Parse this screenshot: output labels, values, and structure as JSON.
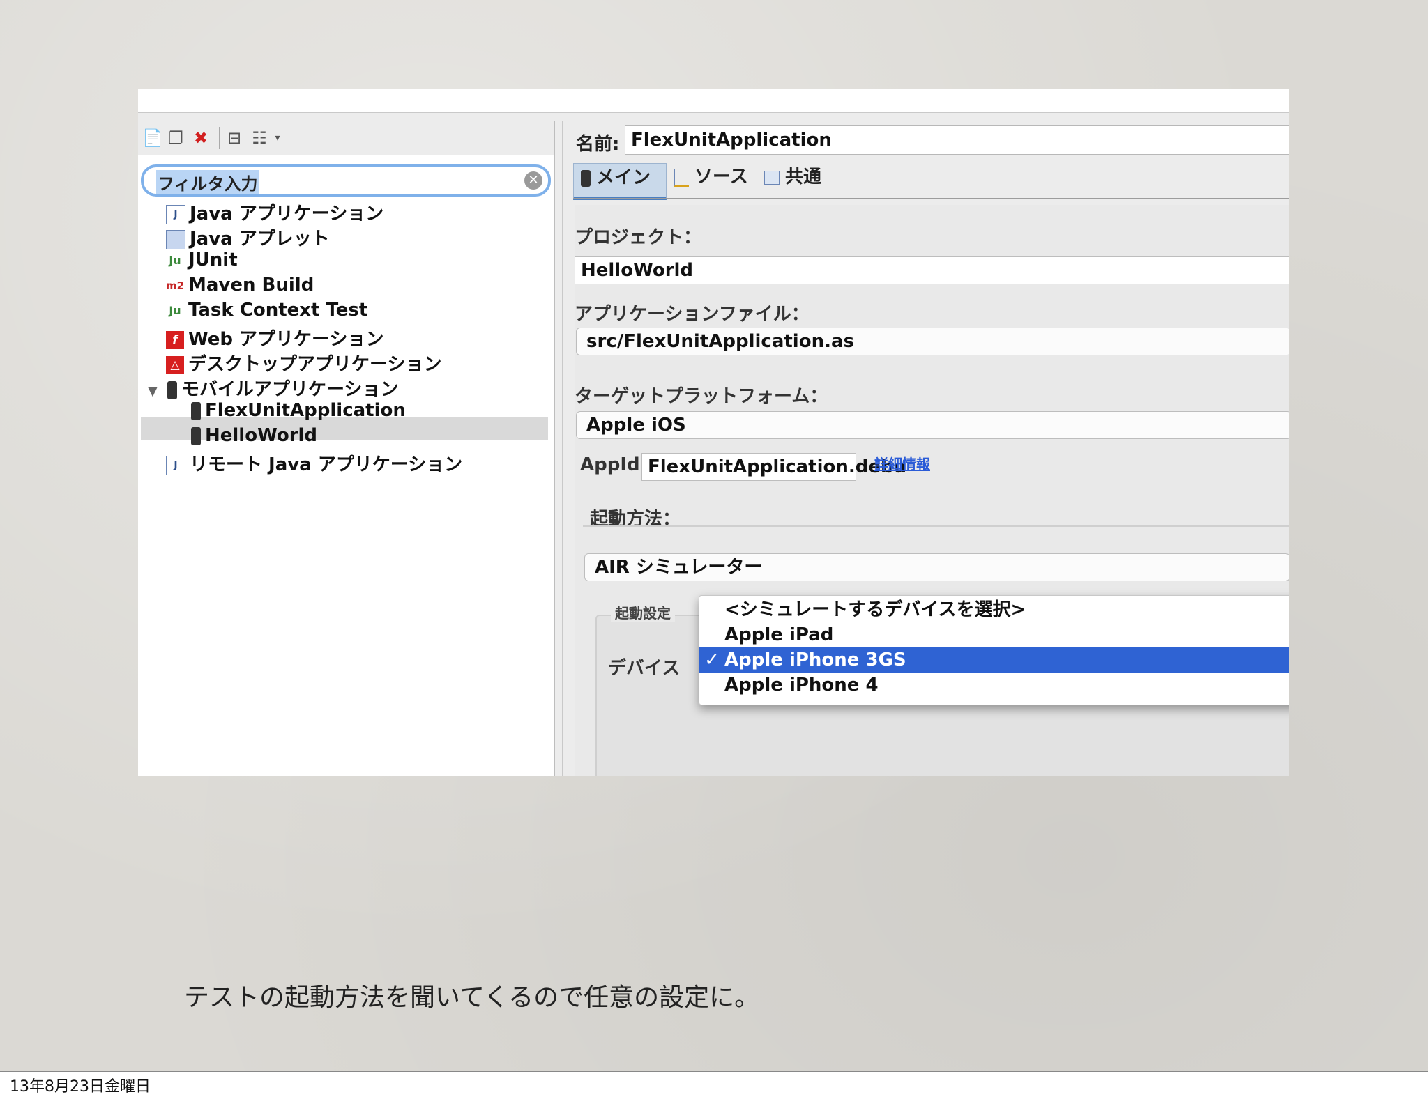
{
  "left_pane": {
    "filter_placeholder": "フィルタ入力",
    "tree": [
      {
        "label": "Java アプリケーション",
        "icon": "java-app-icon"
      },
      {
        "label": "Java アプレット",
        "icon": "applet-icon"
      },
      {
        "label": "JUnit",
        "icon": "junit-icon"
      },
      {
        "label": "Maven Build",
        "icon": "maven-icon"
      },
      {
        "label": "Task Context Test",
        "icon": "task-context-icon"
      },
      {
        "label": "Web アプリケーション",
        "icon": "flash-icon"
      },
      {
        "label": "デスクトップアプリケーション",
        "icon": "air-icon"
      },
      {
        "label": "モバイルアプリケーション",
        "icon": "mobile-device-icon",
        "expanded": true
      },
      {
        "label": "FlexUnitApplication",
        "icon": "mobile-device-icon",
        "selected": true
      },
      {
        "label": "HelloWorld",
        "icon": "mobile-device-icon"
      },
      {
        "label": "リモート Java アプリケーション",
        "icon": "remote-java-icon"
      }
    ]
  },
  "right_pane": {
    "name_label": "名前:",
    "name_value": "FlexUnitApplication",
    "tabs": [
      {
        "label": "メイン",
        "active": true
      },
      {
        "label": "ソース",
        "active": false
      },
      {
        "label": "共通",
        "active": false
      }
    ],
    "project_label": "プロジェクト：",
    "project_value": "HelloWorld",
    "app_file_label": "アプリケーションファイル：",
    "app_file_value": "src/FlexUnitApplication.as",
    "target_label": "ターゲットプラットフォーム：",
    "target_value": "Apple iOS",
    "appid_label": "AppId",
    "appid_value": "FlexUnitApplication.debu",
    "details_link": "詳細情報",
    "launch_method_label": "起動方法：",
    "launch_method_value": "AIR シミュレーター",
    "launch_settings_label": "起動設定",
    "device_label": "デバイス",
    "device_options": [
      {
        "label": "<シミュレートするデバイスを選択>",
        "selected": false
      },
      {
        "label": "Apple iPad",
        "selected": false
      },
      {
        "label": "Apple iPhone 3GS",
        "selected": true
      },
      {
        "label": "Apple iPhone 4",
        "selected": false
      }
    ],
    "checkmark": "✓"
  },
  "caption": "テストの起動方法を聞いてくるので任意の設定に。",
  "footer_date": "13年8月23日金曜日"
}
